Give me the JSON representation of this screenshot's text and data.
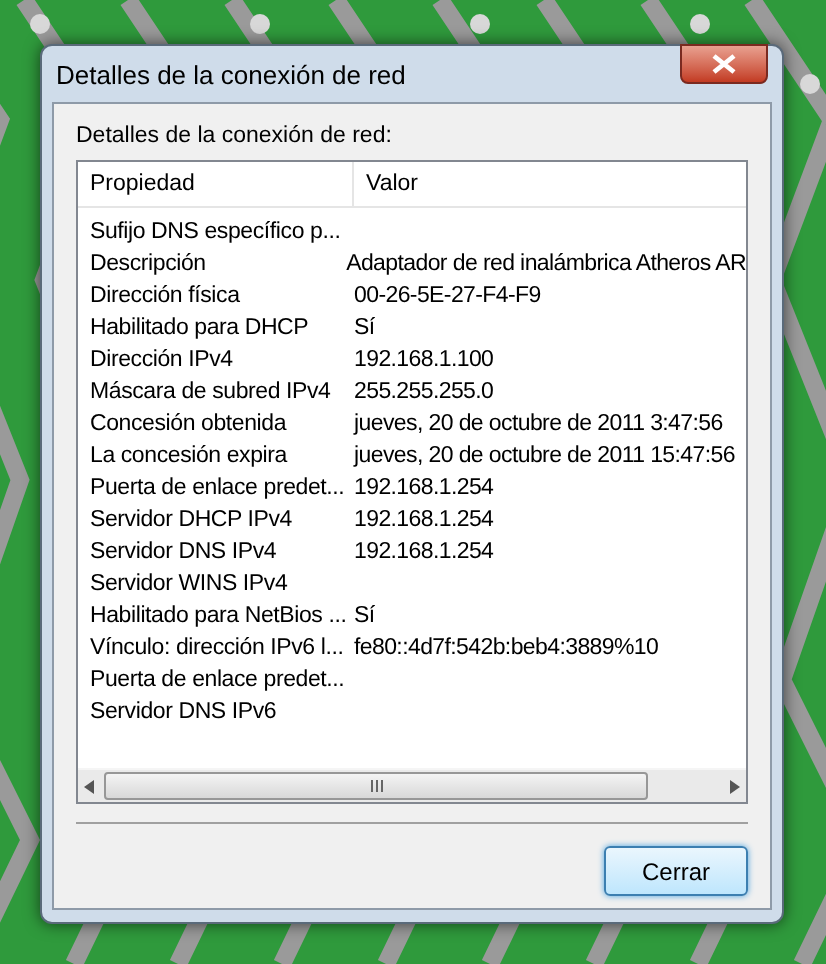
{
  "window": {
    "title": "Detalles de la conexión de red"
  },
  "group_label": "Detalles de la conexión de red:",
  "table": {
    "columns": [
      "Propiedad",
      "Valor"
    ],
    "rows": [
      {
        "property": "Sufijo DNS específico p..."
      },
      {
        "property": "Descripción",
        "value": "Adaptador de red inalámbrica Atheros AR"
      },
      {
        "property": "Dirección física",
        "value": "00-26-5E-27-F4-F9"
      },
      {
        "property": "Habilitado para DHCP",
        "value": "Sí"
      },
      {
        "property": "Dirección IPv4",
        "value": "192.168.1.100"
      },
      {
        "property": "Máscara de subred IPv4",
        "value": "255.255.255.0"
      },
      {
        "property": "Concesión obtenida",
        "value": "jueves, 20 de octubre de 2011 3:47:56"
      },
      {
        "property": "La concesión expira",
        "value": "jueves, 20 de octubre de 2011 15:47:56"
      },
      {
        "property": "Puerta de enlace predet...",
        "value": "192.168.1.254"
      },
      {
        "property": "Servidor DHCP IPv4",
        "value": "192.168.1.254"
      },
      {
        "property": "Servidor DNS IPv4",
        "value": "192.168.1.254"
      },
      {
        "property": "Servidor WINS IPv4"
      },
      {
        "property": "Habilitado para NetBios ...",
        "value": "Sí"
      },
      {
        "property": "Vínculo: dirección IPv6 l...",
        "value": "fe80::4d7f:542b:beb4:3889%10"
      },
      {
        "property": "Puerta de enlace predet..."
      },
      {
        "property": "Servidor DNS IPv6"
      }
    ]
  },
  "buttons": [
    "Cerrar"
  ]
}
